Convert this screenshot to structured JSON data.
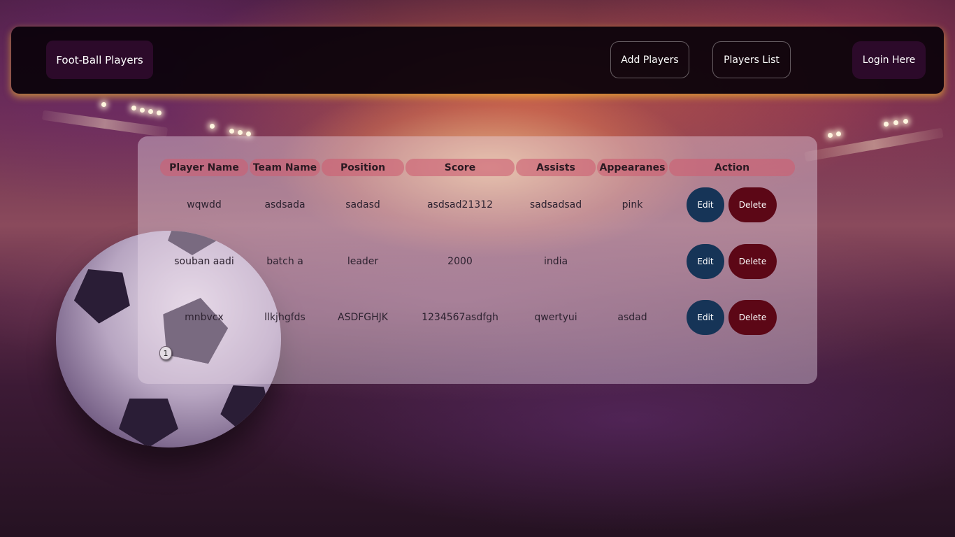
{
  "navbar": {
    "brand": "Foot-Ball Players",
    "add_players": "Add Players",
    "players_list": "Players List",
    "login": "Login Here"
  },
  "table": {
    "headers": [
      "Player Name",
      "Team Name",
      "Position",
      "Score",
      "Assists",
      "Appearanes",
      "Action"
    ],
    "rows": [
      [
        "wqwdd",
        "asdsada",
        "sadasd",
        "asdsad21312",
        "sadsadsad",
        "pink"
      ],
      [
        "souban aadi",
        "batch a",
        "leader",
        "2000",
        "india",
        ""
      ],
      [
        "mnbvcx",
        "llkjhgfds",
        "ASDFGHJK",
        "1234567asdfgh",
        "qwertyui",
        "asdad"
      ]
    ],
    "edit_label": "Edit",
    "delete_label": "Delete"
  },
  "pagination": {
    "current_page": "1"
  },
  "colors": {
    "navbar_bg": "#0a020a",
    "brand_bg": "#2c0a2a",
    "header_pill": "#cd5f73",
    "edit_btn": "#163457",
    "delete_btn": "#5c0716",
    "navbar_glow": "#ffc828"
  }
}
